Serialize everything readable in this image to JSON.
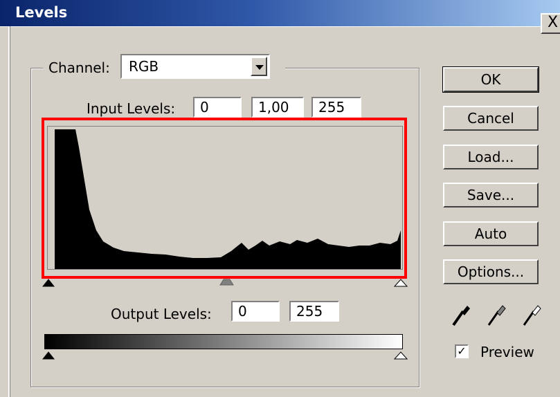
{
  "window": {
    "title": "Levels",
    "close_label": "X"
  },
  "channel": {
    "label": "Channel:",
    "value": "RGB"
  },
  "input_levels": {
    "label": "Input Levels:",
    "black": "0",
    "gamma": "1,00",
    "white": "255"
  },
  "output_levels": {
    "label": "Output Levels:",
    "black": "0",
    "white": "255"
  },
  "buttons": {
    "ok": "OK",
    "cancel": "Cancel",
    "load": "Load...",
    "save": "Save...",
    "auto": "Auto",
    "options": "Options..."
  },
  "preview": {
    "label": "Preview",
    "checked": true,
    "check_mark": "✓"
  },
  "colors": {
    "highlight": "#ff0000",
    "dialog_bg": "#d4d0c8",
    "title_start": "#0a246a",
    "title_end": "#a6caf0"
  }
}
